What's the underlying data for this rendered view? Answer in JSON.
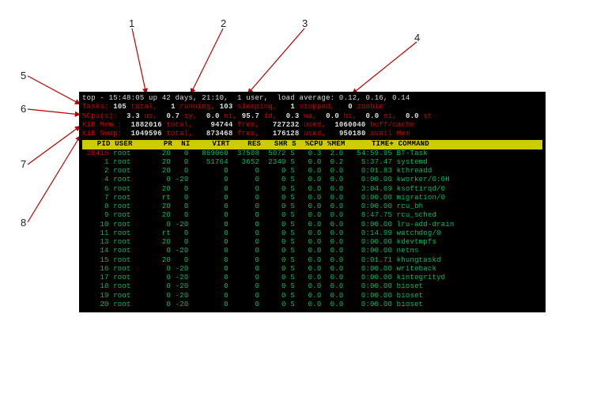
{
  "annotations": {
    "n1": "1",
    "n2": "2",
    "n3": "3",
    "n4": "4",
    "n5": "5",
    "n6": "6",
    "n7": "7",
    "n8": "8"
  },
  "summary": {
    "line1": {
      "prefix": "top - ",
      "time": "15:48:05",
      "up_label": " up ",
      "up_value": "42 days, 21:10,",
      "users": "  1 user,",
      "load_label": "  load average: ",
      "load": "0.12, 0.16, 0.14"
    },
    "tasks": {
      "label": "Tasks:",
      "total_v": "105",
      "total_l": " total,",
      "run_v": "1",
      "run_l": " running,",
      "sleep_v": "103",
      "sleep_l": " sleeping,",
      "stop_v": "1",
      "stop_l": " stopped,",
      "zomb_v": "0",
      "zomb_l": " zombie"
    },
    "cpu": {
      "label": "%Cpu(s):",
      "us_v": "3.3",
      "us_l": " us,",
      "sy_v": "0.7",
      "sy_l": " sy,",
      "ni_v": "0.0",
      "ni_l": " ni,",
      "id_v": "95.7",
      "id_l": " id,",
      "wa_v": "0.3",
      "wa_l": " wa,",
      "hi_v": "0.0",
      "hi_l": " hi,",
      "si_v": "0.0",
      "si_l": " si,",
      "st_v": "0.0",
      "st_l": " st"
    },
    "mem": {
      "label": "KiB Mem :",
      "tot_v": "1882016",
      "tot_l": " total,",
      "free_v": "94744",
      "free_l": " free,",
      "used_v": "727232",
      "used_l": " used,",
      "buf_v": "1060040",
      "buf_l": " buff/cache"
    },
    "swap": {
      "label": "KiB Swap:",
      "tot_v": "1049596",
      "tot_l": " total,",
      "free_v": "873468",
      "free_l": " free,",
      "used_v": "176128",
      "used_l": " used,",
      "avail_v": "950180",
      "avail_l": " avail Mem"
    }
  },
  "header": {
    "pid": "PID",
    "user": "USER",
    "pr": "PR",
    "ni": "NI",
    "virt": "VIRT",
    "res": "RES",
    "shr": "SHR",
    "s": "S",
    "cpu": "%CPU",
    "mem": "%MEM",
    "time": "TIME+",
    "cmd": "COMMAND"
  },
  "processes": [
    {
      "pid": "28416",
      "user": "root",
      "pr": "20",
      "ni": "0",
      "virt": "869060",
      "res": "37508",
      "shr": "5072",
      "s": "S",
      "cpu": "0.3",
      "mem": "2.0",
      "time": "54:59.95",
      "cmd": "BT-Task",
      "hi": true
    },
    {
      "pid": "1",
      "user": "root",
      "pr": "20",
      "ni": "0",
      "virt": "51764",
      "res": "3652",
      "shr": "2340",
      "s": "S",
      "cpu": "0.0",
      "mem": "0.2",
      "time": "5:37.47",
      "cmd": "systemd"
    },
    {
      "pid": "2",
      "user": "root",
      "pr": "20",
      "ni": "0",
      "virt": "0",
      "res": "0",
      "shr": "0",
      "s": "S",
      "cpu": "0.0",
      "mem": "0.0",
      "time": "0:01.83",
      "cmd": "kthreadd"
    },
    {
      "pid": "4",
      "user": "root",
      "pr": "0",
      "ni": "-20",
      "virt": "0",
      "res": "0",
      "shr": "0",
      "s": "S",
      "cpu": "0.0",
      "mem": "0.0",
      "time": "0:00.00",
      "cmd": "kworker/0:0H"
    },
    {
      "pid": "6",
      "user": "root",
      "pr": "20",
      "ni": "0",
      "virt": "0",
      "res": "0",
      "shr": "0",
      "s": "S",
      "cpu": "0.0",
      "mem": "0.0",
      "time": "3:04.69",
      "cmd": "ksoftirqd/0"
    },
    {
      "pid": "7",
      "user": "root",
      "pr": "rt",
      "ni": "0",
      "virt": "0",
      "res": "0",
      "shr": "0",
      "s": "S",
      "cpu": "0.0",
      "mem": "0.0",
      "time": "0:00.00",
      "cmd": "migration/0"
    },
    {
      "pid": "8",
      "user": "root",
      "pr": "20",
      "ni": "0",
      "virt": "0",
      "res": "0",
      "shr": "0",
      "s": "S",
      "cpu": "0.0",
      "mem": "0.0",
      "time": "0:00.00",
      "cmd": "rcu_bh"
    },
    {
      "pid": "9",
      "user": "root",
      "pr": "20",
      "ni": "0",
      "virt": "0",
      "res": "0",
      "shr": "0",
      "s": "S",
      "cpu": "0.0",
      "mem": "0.0",
      "time": "8:47.75",
      "cmd": "rcu_sched"
    },
    {
      "pid": "10",
      "user": "root",
      "pr": "0",
      "ni": "-20",
      "virt": "0",
      "res": "0",
      "shr": "0",
      "s": "S",
      "cpu": "0.0",
      "mem": "0.0",
      "time": "0:00.00",
      "cmd": "lru-add-drain"
    },
    {
      "pid": "11",
      "user": "root",
      "pr": "rt",
      "ni": "0",
      "virt": "0",
      "res": "0",
      "shr": "0",
      "s": "S",
      "cpu": "0.0",
      "mem": "0.0",
      "time": "0:14.99",
      "cmd": "watchdog/0"
    },
    {
      "pid": "13",
      "user": "root",
      "pr": "20",
      "ni": "0",
      "virt": "0",
      "res": "0",
      "shr": "0",
      "s": "S",
      "cpu": "0.0",
      "mem": "0.0",
      "time": "0:00.00",
      "cmd": "kdevtmpfs"
    },
    {
      "pid": "14",
      "user": "root",
      "pr": "0",
      "ni": "-20",
      "virt": "0",
      "res": "0",
      "shr": "0",
      "s": "S",
      "cpu": "0.0",
      "mem": "0.0",
      "time": "0:00.00",
      "cmd": "netns"
    },
    {
      "pid": "15",
      "user": "root",
      "pr": "20",
      "ni": "0",
      "virt": "0",
      "res": "0",
      "shr": "0",
      "s": "S",
      "cpu": "0.0",
      "mem": "0.0",
      "time": "0:01.71",
      "cmd": "khungtaskd"
    },
    {
      "pid": "16",
      "user": "root",
      "pr": "0",
      "ni": "-20",
      "virt": "0",
      "res": "0",
      "shr": "0",
      "s": "S",
      "cpu": "0.0",
      "mem": "0.0",
      "time": "0:00.00",
      "cmd": "writeback"
    },
    {
      "pid": "17",
      "user": "root",
      "pr": "0",
      "ni": "-20",
      "virt": "0",
      "res": "0",
      "shr": "0",
      "s": "S",
      "cpu": "0.0",
      "mem": "0.0",
      "time": "0:00.00",
      "cmd": "kintegrityd"
    },
    {
      "pid": "18",
      "user": "root",
      "pr": "0",
      "ni": "-20",
      "virt": "0",
      "res": "0",
      "shr": "0",
      "s": "S",
      "cpu": "0.0",
      "mem": "0.0",
      "time": "0:00.00",
      "cmd": "bioset"
    },
    {
      "pid": "19",
      "user": "root",
      "pr": "0",
      "ni": "-20",
      "virt": "0",
      "res": "0",
      "shr": "0",
      "s": "S",
      "cpu": "0.0",
      "mem": "0.0",
      "time": "0:00.00",
      "cmd": "bioset"
    },
    {
      "pid": "20",
      "user": "root",
      "pr": "0",
      "ni": "-20",
      "virt": "0",
      "res": "0",
      "shr": "0",
      "s": "S",
      "cpu": "0.0",
      "mem": "0.0",
      "time": "0:00.00",
      "cmd": "bioset"
    }
  ],
  "colors": {
    "red": "#c00",
    "green": "#0b6",
    "yellow": "#cccc00"
  }
}
